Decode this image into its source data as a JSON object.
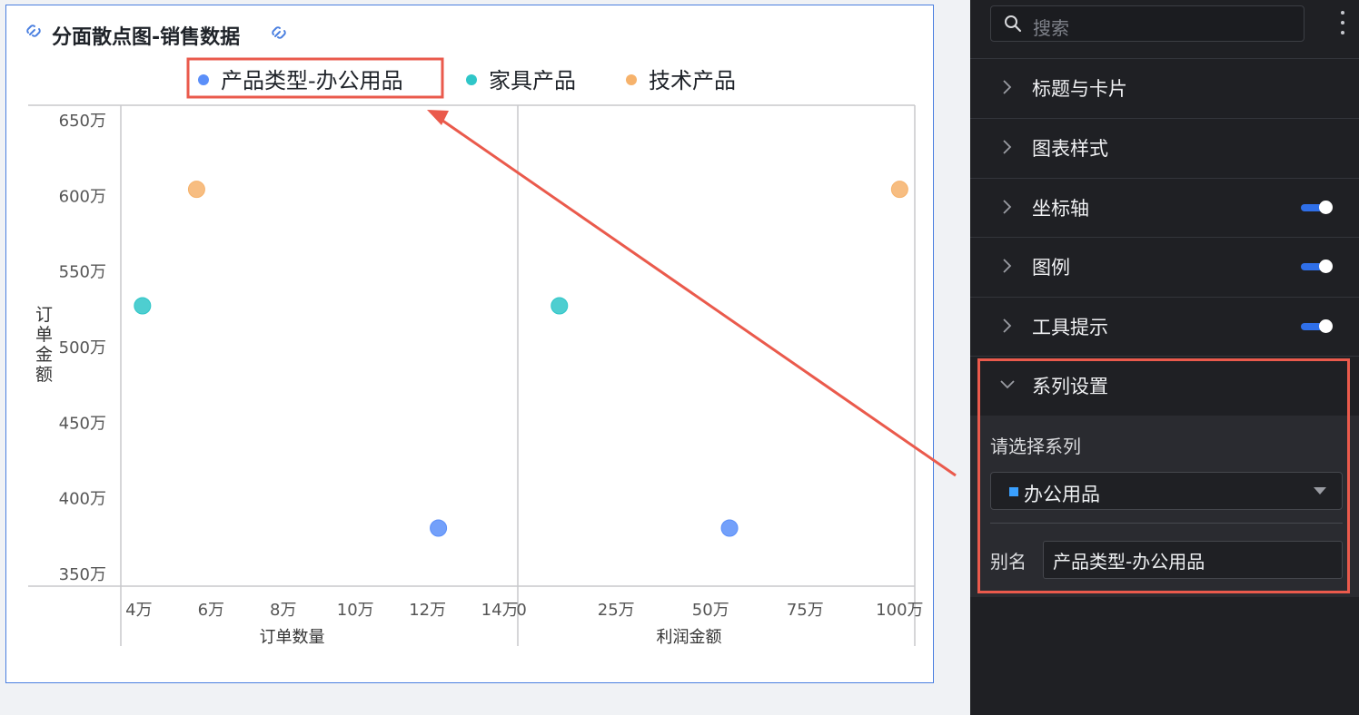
{
  "chart": {
    "title": "分面散点图-销售数据",
    "legend": [
      {
        "label": "产品类型-办公用品",
        "color": "#5b8ff9"
      },
      {
        "label": "家具产品",
        "color": "#2fc6c8"
      },
      {
        "label": "技术产品",
        "color": "#f6b26b"
      }
    ],
    "y_axis_title": "订单金额"
  },
  "chart_data": {
    "type": "scatter",
    "y": {
      "label": "订单金额",
      "unit": "万",
      "range": [
        350,
        650
      ],
      "ticks": [
        350,
        400,
        450,
        500,
        550,
        600,
        650
      ],
      "tick_labels": [
        "350万",
        "400万",
        "450万",
        "500万",
        "550万",
        "600万",
        "650万"
      ]
    },
    "facets": [
      {
        "xlabel": "订单数量",
        "x_range": [
          3.5,
          14.5
        ],
        "x_ticks": [
          4,
          6,
          8,
          10,
          12,
          14
        ],
        "x_tick_labels": [
          "4万",
          "6万",
          "8万",
          "10万",
          "12万",
          "14万"
        ],
        "points": [
          {
            "series": "产品类型-办公用品",
            "x": 12.3,
            "y": 380
          },
          {
            "series": "家具产品",
            "x": 4.1,
            "y": 527
          },
          {
            "series": "技术产品",
            "x": 5.6,
            "y": 604
          }
        ]
      },
      {
        "xlabel": "利润金额",
        "x_range": [
          -1,
          104
        ],
        "x_ticks": [
          0,
          25,
          50,
          75,
          100
        ],
        "x_tick_labels": [
          "0",
          "25万",
          "50万",
          "75万",
          "100万"
        ],
        "points": [
          {
            "series": "产品类型-办公用品",
            "x": 55,
            "y": 380
          },
          {
            "series": "家具产品",
            "x": 10,
            "y": 527
          },
          {
            "series": "技术产品",
            "x": 100,
            "y": 604
          }
        ]
      }
    ],
    "series": [
      {
        "name": "产品类型-办公用品",
        "color": "#5b8ff9"
      },
      {
        "name": "家具产品",
        "color": "#2fc6c8"
      },
      {
        "name": "技术产品",
        "color": "#f6b26b"
      }
    ],
    "grid": false,
    "legend_position": "top-center"
  },
  "panel": {
    "search_placeholder": "搜索",
    "sections": [
      {
        "label": "标题与卡片",
        "toggle": false
      },
      {
        "label": "图表样式",
        "toggle": false
      },
      {
        "label": "坐标轴",
        "toggle": true
      },
      {
        "label": "图例",
        "toggle": true
      },
      {
        "label": "工具提示",
        "toggle": true
      }
    ],
    "series_section": {
      "label": "系列设置",
      "select_label": "请选择系列",
      "selected_series": "办公用品",
      "selected_color": "#3aa0ff",
      "alias_label": "别名",
      "alias_value": "产品类型-办公用品"
    }
  },
  "colors": {
    "accent": "#2f6fe8",
    "highlight": "#ea5a4c"
  }
}
